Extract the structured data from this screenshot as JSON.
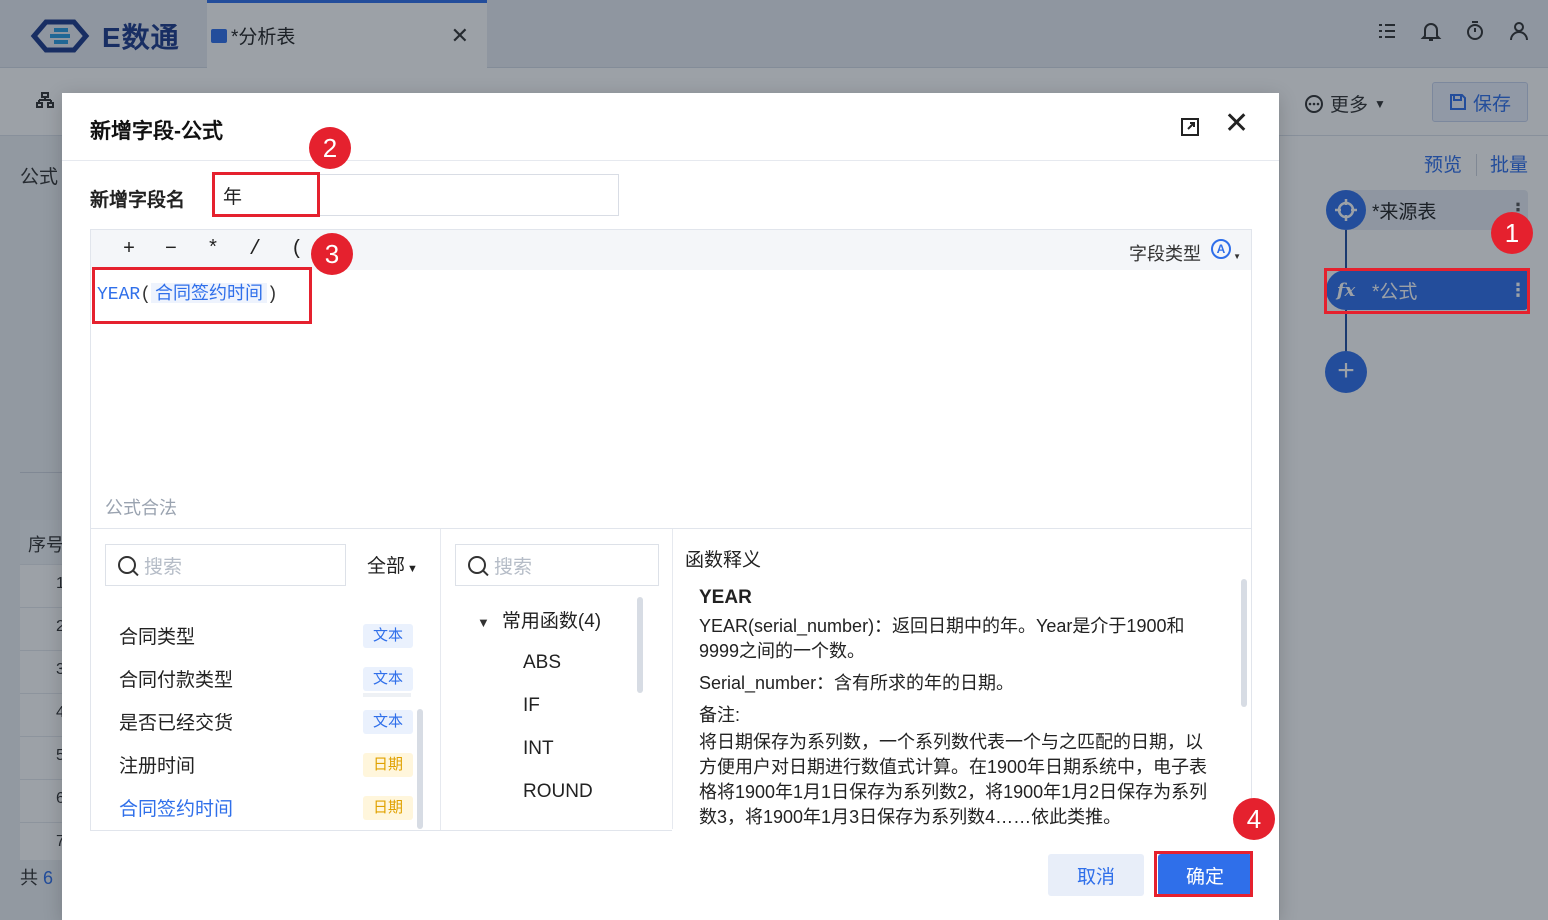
{
  "app": {
    "logo_text": "E数通",
    "tab_title": "*分析表",
    "tab_close": "✕"
  },
  "toolbar": {
    "more_label": "更多",
    "save_label": "保存"
  },
  "background": {
    "left_label": "公式",
    "grid_header": "序号",
    "row_numbers": [
      "1",
      "2",
      "3",
      "4",
      "5",
      "6",
      "7"
    ],
    "footer_prefix": "共",
    "footer_count": "6"
  },
  "right_panel": {
    "preview_label": "预览",
    "batch_label": "批量",
    "node_source_label": "*来源表",
    "node_formula_label": "*公式",
    "fx_label": "fx",
    "add_label": "+"
  },
  "dialog": {
    "title": "新增字段-公式",
    "name_label": "新增字段名",
    "name_value": "年",
    "operators": [
      "+",
      "−",
      "*",
      "/",
      "("
    ],
    "field_type_label": "字段类型",
    "field_type_icon": "A",
    "formula": {
      "function": "YEAR",
      "open": "(",
      "field": "合同签约时间",
      "close": ")"
    },
    "validation_text": "公式合法",
    "fields_search_placeholder": "搜索",
    "fields_filter": "全部",
    "fields": [
      {
        "name": "合同类型",
        "type": "文本",
        "kind": "text"
      },
      {
        "name": "合同付款类型",
        "type": "文本",
        "kind": "text"
      },
      {
        "name": "是否已经交货",
        "type": "文本",
        "kind": "text"
      },
      {
        "name": "注册时间",
        "type": "日期",
        "kind": "date"
      },
      {
        "name": "合同签约时间",
        "type": "日期",
        "kind": "date",
        "active": true
      }
    ],
    "func_search_placeholder": "搜索",
    "func_group": "常用函数(4)",
    "functions": [
      "ABS",
      "IF",
      "INT",
      "ROUND"
    ],
    "doc_title": "函数释义",
    "doc": {
      "name": "YEAR",
      "desc": "YEAR(serial_number)：返回日期中的年。Year是介于1900和9999之间的一个数。",
      "param": "Serial_number：含有所求的年的日期。",
      "note_label": "备注:",
      "note": "将日期保存为系列数，一个系列数代表一个与之匹配的日期，以方便用户对日期进行数值式计算。在1900年日期系统中，电子表格将1900年1月1日保存为系列数2，将1900年1月2日保存为系列数3，将1900年1月3日保存为系列数4……依此类推。"
    },
    "cancel_label": "取消",
    "ok_label": "确定"
  },
  "markers": [
    "1",
    "2",
    "3",
    "4"
  ],
  "colors": {
    "accent": "#2f6fea",
    "highlight": "#e5212e",
    "date_badge": "#e0a100"
  }
}
